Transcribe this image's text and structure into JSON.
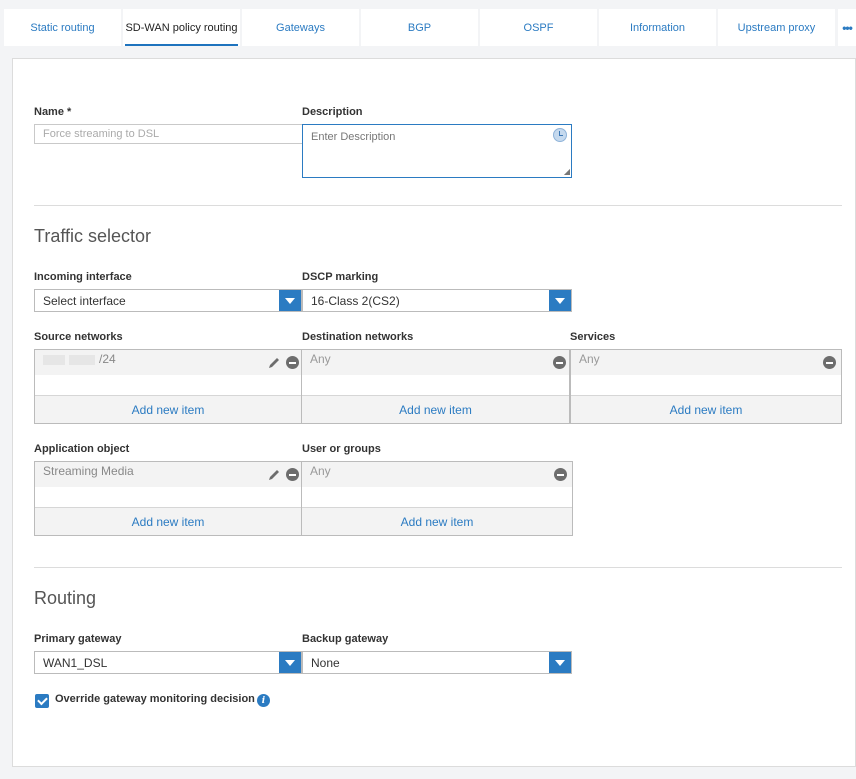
{
  "tabs": [
    {
      "label": "Static routing",
      "active": false
    },
    {
      "label": "SD-WAN policy routing",
      "active": true
    },
    {
      "label": "Gateways",
      "active": false
    },
    {
      "label": "BGP",
      "active": false
    },
    {
      "label": "OSPF",
      "active": false
    },
    {
      "label": "Information",
      "active": false
    },
    {
      "label": "Upstream proxy",
      "active": false
    }
  ],
  "more_icon": "more-icon",
  "form": {
    "name_label": "Name *",
    "name_placeholder": "Force streaming to DSL",
    "description_label": "Description",
    "description_placeholder": "Enter Description"
  },
  "traffic": {
    "title": "Traffic selector",
    "incoming_label": "Incoming interface",
    "incoming_value": "Select interface",
    "dscp_label": "DSCP marking",
    "dscp_value": "16-Class 2(CS2)",
    "source_label": "Source networks",
    "source_item": "/24",
    "dest_label": "Destination networks",
    "dest_item": "Any",
    "services_label": "Services",
    "services_item": "Any",
    "app_label": "Application object",
    "app_item": "Streaming Media",
    "users_label": "User or groups",
    "users_item": "Any",
    "add_label": "Add new item"
  },
  "routing": {
    "title": "Routing",
    "primary_label": "Primary gateway",
    "primary_value": "WAN1_DSL",
    "backup_label": "Backup gateway",
    "backup_value": "None",
    "override_label": "Override gateway monitoring decision",
    "override_checked": true
  },
  "colors": {
    "accent": "#2b7bc2",
    "tab_active_underline": "#1e73be"
  }
}
